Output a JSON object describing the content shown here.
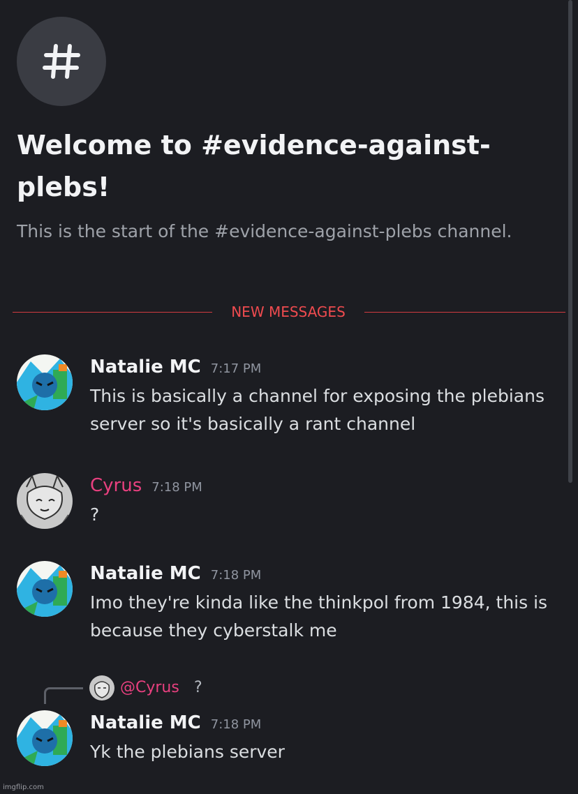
{
  "channel": {
    "icon": "hash-icon",
    "welcome_title": "Welcome to #evidence-against-plebs!",
    "welcome_subtitle": "This is the start of the #evidence-against-plebs channel."
  },
  "divider": {
    "label": "NEW MESSAGES",
    "color": "#ef4b4f"
  },
  "messages": [
    {
      "author": "Natalie MC",
      "time": "7:17 PM",
      "text": "This is basically a channel for exposing the plebians server so it's basically a rant channel"
    },
    {
      "author": "Cyrus",
      "time": "7:18 PM",
      "text": "?",
      "author_color": "#e8407f"
    },
    {
      "author": "Natalie MC",
      "time": "7:18 PM",
      "text": "Imo they're kinda like the thinkpol from 1984, this is because they cyberstalk me"
    },
    {
      "reply": {
        "mention": "@Cyrus",
        "text": "?"
      },
      "author": "Natalie MC",
      "time": "7:18 PM",
      "text": "Yk the plebians server"
    }
  ],
  "watermark": "imgflip.com",
  "colors": {
    "background": "#1c1d22",
    "mention": "#e8407f",
    "new_messages": "#ef4b4f"
  }
}
